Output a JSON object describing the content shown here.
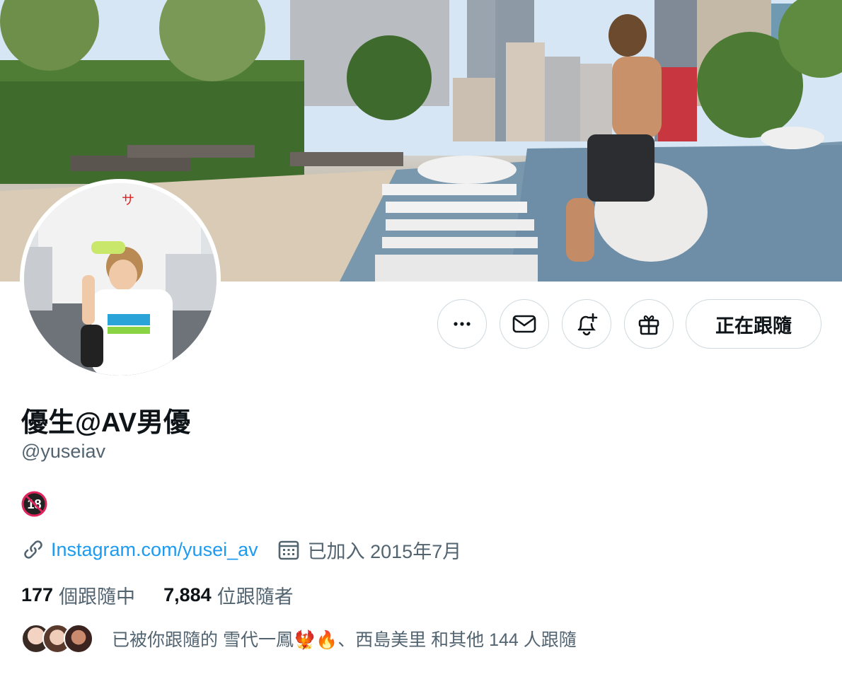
{
  "profile": {
    "display_name": "優生@AV男優",
    "handle": "@yuseiav",
    "age_badge": "18",
    "website_label": "Instagram.com/yusei_av",
    "joined": "已加入 2015年7月"
  },
  "actions": {
    "more_icon": "ellipsis-icon",
    "message_icon": "envelope-icon",
    "notify_icon": "bell-plus-icon",
    "gift_icon": "gift-icon",
    "following_label": "正在跟隨"
  },
  "stats": {
    "following_count": "177",
    "following_label": "個跟隨中",
    "followers_count": "7,884",
    "followers_label": "位跟隨者"
  },
  "followed_by": {
    "text": "已被你跟隨的 雪代一鳳🐦‍🔥🔥、西島美里 和其他 144 人跟隨"
  },
  "colors": {
    "accent": "#1d9bf0",
    "text_primary": "#0f1419",
    "text_secondary": "#536471",
    "border": "#cfd9de",
    "badge_red": "#e0245e"
  }
}
